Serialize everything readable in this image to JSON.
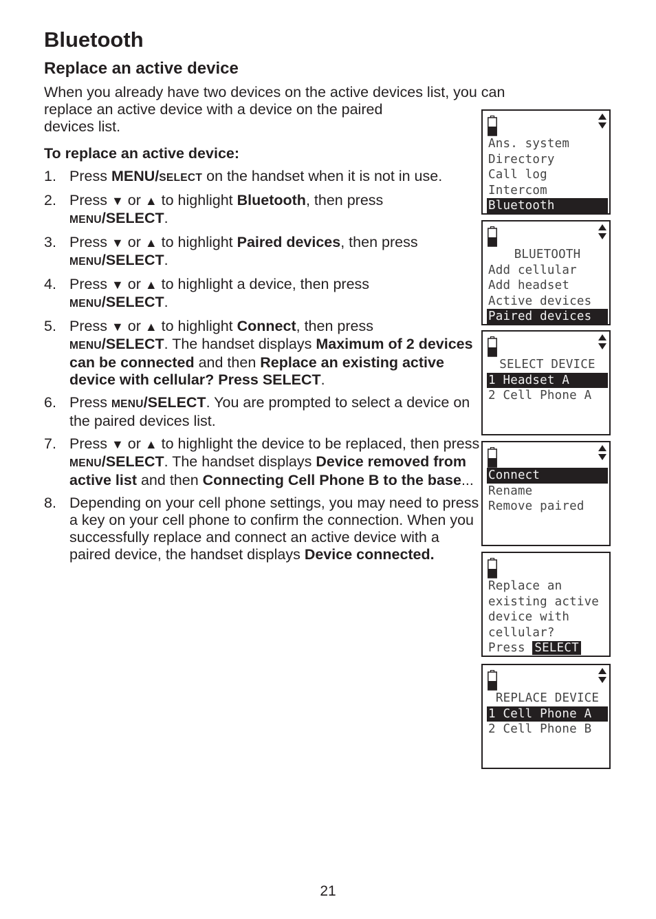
{
  "page": {
    "title": "Bluetooth",
    "section_title": "Replace an active device",
    "intro_lines": [
      "When you already have two devices on the active devices list, you can",
      "replace an active device with a device on the paired",
      "devices list."
    ],
    "procedure_title": "To replace an active device:",
    "page_number": "21"
  },
  "icons": {
    "down_triangle": "▼",
    "up_triangle": "▲"
  },
  "steps": [
    {
      "num": "1.",
      "parts": {
        "a": "Press ",
        "b": "MENU/",
        "c": "SELECT",
        "d": " on the handset when it is not in use."
      }
    },
    {
      "num": "2.",
      "parts": {
        "a": "Press ",
        "b": " or ",
        "c": " to highlight ",
        "d": "Bluetooth",
        "e": ", then press ",
        "f": "MENU",
        "g": "/SELECT",
        "h": "."
      }
    },
    {
      "num": "3.",
      "parts": {
        "a": "Press ",
        "b": " or ",
        "c": " to highlight ",
        "d": "Paired devices",
        "e": ", then press ",
        "f": "MENU",
        "g": "/SELECT",
        "h": "."
      }
    },
    {
      "num": "4.",
      "parts": {
        "a": "Press ",
        "b": " or ",
        "c": " to highlight a device, then press ",
        "f": "MENU",
        "g": "/SELECT",
        "h": "."
      }
    },
    {
      "num": "5.",
      "parts": {
        "a": "Press ",
        "b": " or ",
        "c": " to highlight ",
        "d": "Connect",
        "e": ", then press ",
        "f": "MENU",
        "g": "/SELECT",
        "h": ". The handset displays ",
        "i": "Maximum of 2 devices can be connected",
        "j": " and then ",
        "k": "Replace an existing active device with cellular? Press SELECT",
        "l": "."
      }
    },
    {
      "num": "6.",
      "parts": {
        "a": "Press ",
        "f": "MENU",
        "g": "/SELECT",
        "h": ". You are prompted to select a device on the paired devices list."
      }
    },
    {
      "num": "7.",
      "parts": {
        "a": "Press ",
        "b": " or ",
        "c": " to highlight the device to be replaced, then press ",
        "f": "MENU",
        "g": "/SELECT",
        "h": ". The handset displays ",
        "i": "Device removed from active list",
        "j": " and then ",
        "k": "Connecting Cell Phone B to the base",
        "l": "..."
      }
    },
    {
      "num": "8.",
      "parts": {
        "a": "Depending on your cell phone settings, you may need to press a key on your cell phone to confirm the connection. When you successfully replace and connect an active device with a paired device, the handset displays ",
        "d": "Device connected."
      }
    }
  ],
  "screens": [
    {
      "lines": [
        "Ans. system",
        "Directory",
        "Call log",
        "Intercom",
        "Bluetooth"
      ],
      "highlight": 4,
      "arrows": true
    },
    {
      "lines": [
        "BLUETOOTH",
        "Add cellular",
        "Add headset",
        "Active devices",
        "Paired devices"
      ],
      "highlight": 4,
      "arrows": true
    },
    {
      "lines": [
        "SELECT DEVICE",
        "1 Headset A",
        "2 Cell Phone A"
      ],
      "highlight": 1,
      "arrows": true
    },
    {
      "lines": [
        "Connect",
        "Rename",
        "Remove paired"
      ],
      "highlight": 0,
      "arrows": true
    },
    {
      "lines": [
        "Replace an",
        "existing active",
        "device with",
        "cellular?",
        "Press "
      ],
      "highlight_word": "SELECT",
      "arrows": false
    },
    {
      "lines": [
        "REPLACE DEVICE",
        "1 Cell Phone A",
        "2 Cell Phone B"
      ],
      "highlight": 1,
      "arrows": true
    }
  ]
}
